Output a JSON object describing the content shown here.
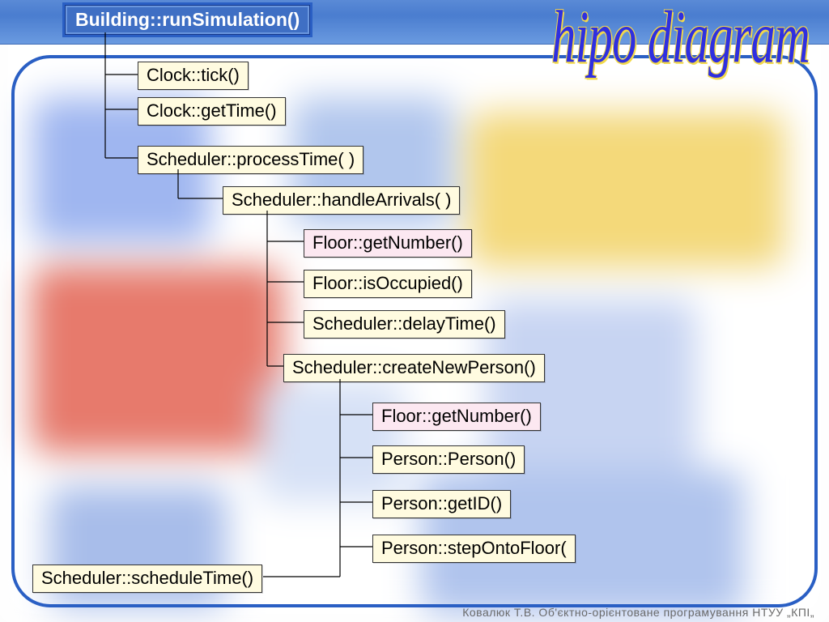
{
  "title": "hipo diagram",
  "footer": "Ковалюк Т.В. Об'єктно-орієнтоване програмування НТУУ „КПІ„",
  "nodes": {
    "root": "Building::runSimulation()",
    "clock_tick": "Clock::tick()",
    "clock_getTime": "Clock::getTime()",
    "sched_process": "Scheduler::processTime( )",
    "sched_handle": "Scheduler::handleArrivals( )",
    "floor_getNum1": "Floor::getNumber()",
    "floor_isOcc": "Floor::isOccupied()",
    "sched_delay": "Scheduler::delayTime()",
    "sched_create": "Scheduler::createNewPerson()",
    "floor_getNum2": "Floor::getNumber()",
    "person_ctor": "Person::Person()",
    "person_getId": "Person::getID()",
    "person_step": "Person::stepOntoFloor(",
    "sched_schedule": "Scheduler::scheduleTime()"
  }
}
